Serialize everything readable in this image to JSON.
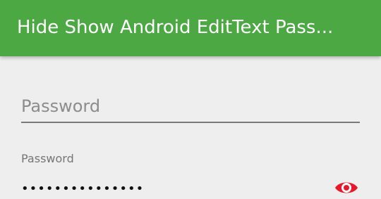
{
  "toolbar": {
    "title": "Hide Show Android EditText Pass...",
    "color": "#4ca843"
  },
  "password_field_1": {
    "placeholder": "Password",
    "value": ""
  },
  "password_field_2": {
    "label": "Password",
    "masked_value": "•••••••••••••••",
    "toggle_icon": "eye-icon",
    "toggle_color": "#e8172b"
  }
}
